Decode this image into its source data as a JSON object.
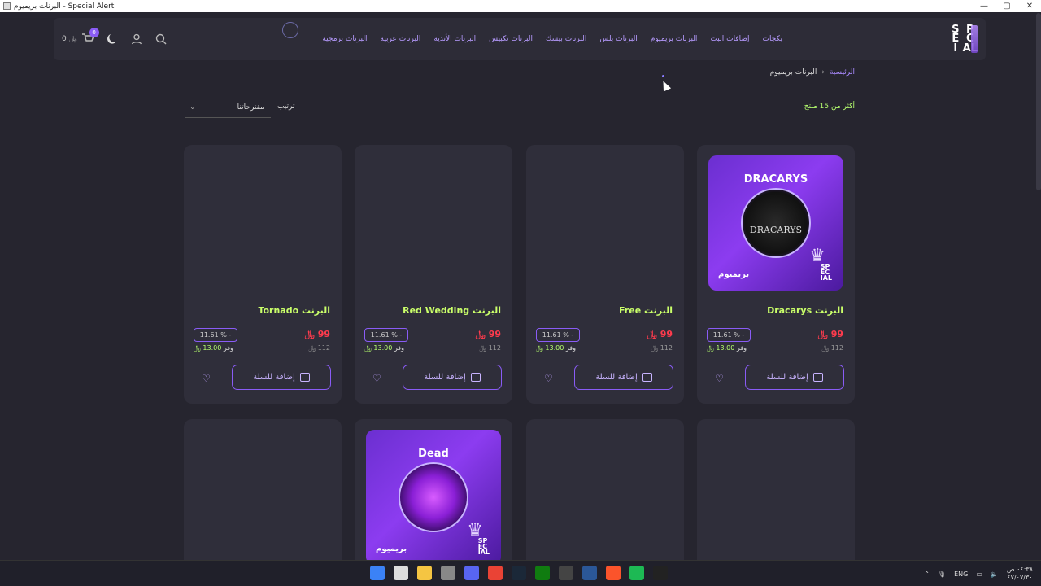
{
  "window": {
    "title": "البرنات بريميوم - Special Alert",
    "controls": [
      "—",
      "▢",
      "✕"
    ]
  },
  "header": {
    "logo_letters": [
      "S",
      "P",
      "E",
      "C",
      "I",
      "AL"
    ],
    "nav": [
      "بكجات",
      "إضافات البث",
      "البرنات بريميوم",
      "البرنات بلس",
      "البرنات بيسك",
      "البرنات تكبيس",
      "البرنات الأندية",
      "البرنات عربية",
      "البرنات برمجية"
    ],
    "cart_count": "0",
    "cart_total": "0 ﷼",
    "icons": [
      "search-icon",
      "user-icon",
      "moon-icon",
      "cart-icon"
    ]
  },
  "breadcrumb": {
    "home": "الرئيسية",
    "separator": "‹",
    "current": "البرنات بريميوم"
  },
  "toolbar": {
    "count": "أكثر من 15 منتج",
    "sort_label": "ترتيب",
    "sort_value": "مقترحاتنا",
    "sort_chevron": "⌄"
  },
  "products": [
    {
      "name": "البرنت Dracarys",
      "price": "99 ﷼",
      "old_price": "112 ﷼",
      "discount": "11.61 % -",
      "save_label": "وفر",
      "save_amount": "13.00 ﷼",
      "add_label": "إضافة للسلة",
      "thumb_title": "DRACARYS",
      "thumb_inner": "DRACARYS",
      "thumb_badge": "بريميوم"
    },
    {
      "name": "البرنت Free",
      "price": "99 ﷼",
      "old_price": "112 ﷼",
      "discount": "11.61 % -",
      "save_label": "وفر",
      "save_amount": "13.00 ﷼",
      "add_label": "إضافة للسلة"
    },
    {
      "name": "البرنت Red Wedding",
      "price": "99 ﷼",
      "old_price": "112 ﷼",
      "discount": "11.61 % -",
      "save_label": "وفر",
      "save_amount": "13.00 ﷼",
      "add_label": "إضافة للسلة"
    },
    {
      "name": "البرنت Tornado",
      "price": "99 ﷼",
      "old_price": "112 ﷼",
      "discount": "11.61 % -",
      "save_label": "وفر",
      "save_amount": "13.00 ﷼",
      "add_label": "إضافة للسلة"
    }
  ],
  "row2": [
    {
      "thumb_title": "Dead",
      "thumb_badge": "بريميوم"
    }
  ],
  "taskbar": {
    "lang": "ENG",
    "time": "٠٤:٣٨ ص",
    "date": "٤٧/٠٧/٣٠"
  },
  "colors": {
    "accent": "#8a5cf6",
    "price": "#ff3b4d",
    "name": "#caff6a",
    "bg": "#26252f",
    "card": "#2f2e3a"
  }
}
